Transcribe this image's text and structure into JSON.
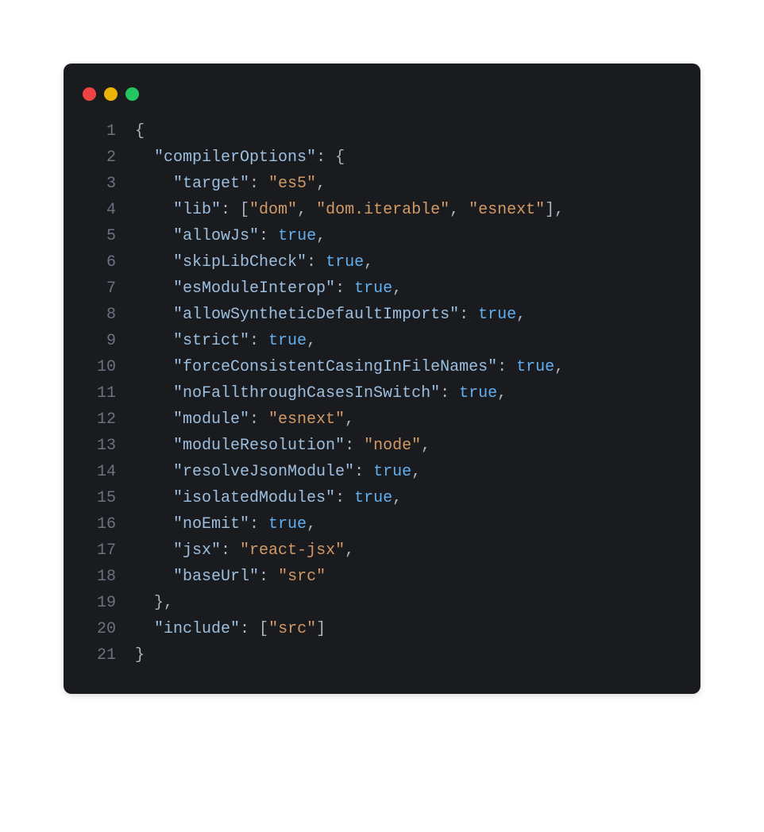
{
  "lineCount": 21,
  "colors": {
    "punctuation": "#abb2bf",
    "key": "#9cbfe0",
    "string": "#d19a66",
    "boolean": "#61afef"
  },
  "lines": [
    [
      [
        "punc",
        "{"
      ]
    ],
    [
      [
        "punc",
        "  "
      ],
      [
        "key",
        "\"compilerOptions\""
      ],
      [
        "punc",
        ": {"
      ]
    ],
    [
      [
        "punc",
        "    "
      ],
      [
        "key",
        "\"target\""
      ],
      [
        "punc",
        ": "
      ],
      [
        "str",
        "\"es5\""
      ],
      [
        "punc",
        ","
      ]
    ],
    [
      [
        "punc",
        "    "
      ],
      [
        "key",
        "\"lib\""
      ],
      [
        "punc",
        ": ["
      ],
      [
        "str",
        "\"dom\""
      ],
      [
        "punc",
        ", "
      ],
      [
        "str",
        "\"dom.iterable\""
      ],
      [
        "punc",
        ", "
      ],
      [
        "str",
        "\"esnext\""
      ],
      [
        "punc",
        "],"
      ]
    ],
    [
      [
        "punc",
        "    "
      ],
      [
        "key",
        "\"allowJs\""
      ],
      [
        "punc",
        ": "
      ],
      [
        "bool",
        "true"
      ],
      [
        "punc",
        ","
      ]
    ],
    [
      [
        "punc",
        "    "
      ],
      [
        "key",
        "\"skipLibCheck\""
      ],
      [
        "punc",
        ": "
      ],
      [
        "bool",
        "true"
      ],
      [
        "punc",
        ","
      ]
    ],
    [
      [
        "punc",
        "    "
      ],
      [
        "key",
        "\"esModuleInterop\""
      ],
      [
        "punc",
        ": "
      ],
      [
        "bool",
        "true"
      ],
      [
        "punc",
        ","
      ]
    ],
    [
      [
        "punc",
        "    "
      ],
      [
        "key",
        "\"allowSyntheticDefaultImports\""
      ],
      [
        "punc",
        ": "
      ],
      [
        "bool",
        "true"
      ],
      [
        "punc",
        ","
      ]
    ],
    [
      [
        "punc",
        "    "
      ],
      [
        "key",
        "\"strict\""
      ],
      [
        "punc",
        ": "
      ],
      [
        "bool",
        "true"
      ],
      [
        "punc",
        ","
      ]
    ],
    [
      [
        "punc",
        "    "
      ],
      [
        "key",
        "\"forceConsistentCasingInFileNames\""
      ],
      [
        "punc",
        ": "
      ],
      [
        "bool",
        "true"
      ],
      [
        "punc",
        ","
      ]
    ],
    [
      [
        "punc",
        "    "
      ],
      [
        "key",
        "\"noFallthroughCasesInSwitch\""
      ],
      [
        "punc",
        ": "
      ],
      [
        "bool",
        "true"
      ],
      [
        "punc",
        ","
      ]
    ],
    [
      [
        "punc",
        "    "
      ],
      [
        "key",
        "\"module\""
      ],
      [
        "punc",
        ": "
      ],
      [
        "str",
        "\"esnext\""
      ],
      [
        "punc",
        ","
      ]
    ],
    [
      [
        "punc",
        "    "
      ],
      [
        "key",
        "\"moduleResolution\""
      ],
      [
        "punc",
        ": "
      ],
      [
        "str",
        "\"node\""
      ],
      [
        "punc",
        ","
      ]
    ],
    [
      [
        "punc",
        "    "
      ],
      [
        "key",
        "\"resolveJsonModule\""
      ],
      [
        "punc",
        ": "
      ],
      [
        "bool",
        "true"
      ],
      [
        "punc",
        ","
      ]
    ],
    [
      [
        "punc",
        "    "
      ],
      [
        "key",
        "\"isolatedModules\""
      ],
      [
        "punc",
        ": "
      ],
      [
        "bool",
        "true"
      ],
      [
        "punc",
        ","
      ]
    ],
    [
      [
        "punc",
        "    "
      ],
      [
        "key",
        "\"noEmit\""
      ],
      [
        "punc",
        ": "
      ],
      [
        "bool",
        "true"
      ],
      [
        "punc",
        ","
      ]
    ],
    [
      [
        "punc",
        "    "
      ],
      [
        "key",
        "\"jsx\""
      ],
      [
        "punc",
        ": "
      ],
      [
        "str",
        "\"react-jsx\""
      ],
      [
        "punc",
        ","
      ]
    ],
    [
      [
        "punc",
        "    "
      ],
      [
        "key",
        "\"baseUrl\""
      ],
      [
        "punc",
        ": "
      ],
      [
        "str",
        "\"src\""
      ]
    ],
    [
      [
        "punc",
        "  },"
      ]
    ],
    [
      [
        "punc",
        "  "
      ],
      [
        "key",
        "\"include\""
      ],
      [
        "punc",
        ": ["
      ],
      [
        "str",
        "\"src\""
      ],
      [
        "punc",
        "]"
      ]
    ],
    [
      [
        "punc",
        "}"
      ]
    ]
  ]
}
